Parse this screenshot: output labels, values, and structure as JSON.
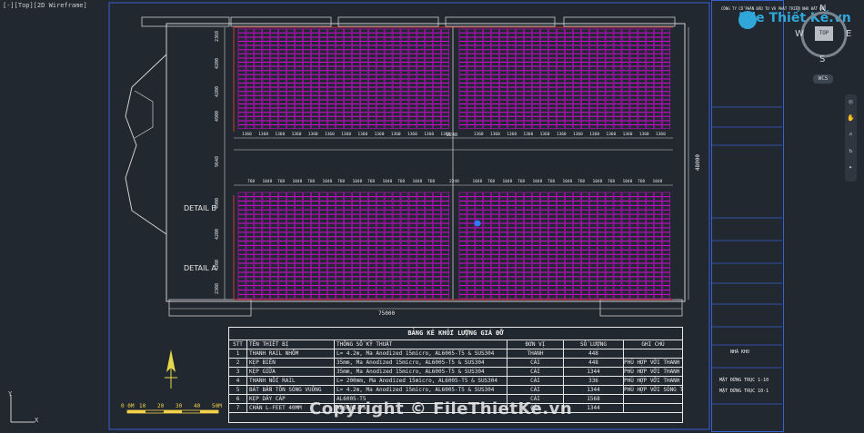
{
  "viewport": {
    "label": "[-][Top][2D Wireframe]"
  },
  "detail_labels": [
    "DETAIL B",
    "DETAIL A"
  ],
  "dimensions": {
    "overall_width": "75000",
    "left_side": [
      "2368",
      "4200",
      "4200",
      "4900",
      "9648",
      "4900",
      "4200",
      "4200",
      "2308"
    ],
    "right_side": "48000",
    "top_spacing": "1360",
    "lower_spacing": [
      "768",
      "1048"
    ],
    "center": "2248"
  },
  "table": {
    "title": "BẢNG KÊ KHỐI LƯỢNG GIÁ ĐỠ",
    "headers": [
      "STT",
      "TÊN THIẾT BỊ",
      "THÔNG SỐ KỸ THUẬT",
      "ĐƠN VỊ",
      "SỐ LƯỢNG",
      "GHI CHÚ"
    ],
    "rows": [
      [
        "1",
        "THANH RAIL NHÔM",
        "L= 4.2m, Ma Anodized 15micro, AL6005-T5 & SUS304",
        "THANH",
        "448",
        ""
      ],
      [
        "2",
        "KẸP BIÊN",
        "35mm, Ma Anodized 15micro, AL6005-T5 & SUS304",
        "CÁI",
        "448",
        "PHÙ HỢP VỚI THANH RAIL"
      ],
      [
        "3",
        "KẸP GIỮA",
        "35mm, Ma Anodized 15micro, AL6005-T5 & SUS304",
        "CÁI",
        "1344",
        "PHÙ HỢP VỚI THANH RAIL"
      ],
      [
        "4",
        "THANH NỐI RAIL",
        "L= 200mm, Ma Anodized 15micro, AL6005-T5 & SUS304",
        "CÁI",
        "336",
        "PHÙ HỢP VỚI THANH RAIL"
      ],
      [
        "5",
        "BÁT BẮN TÔN SÓNG VUÔNG",
        "L= 4.2m, Ma Anodized 15micro, AL6005-T5 & SUS304",
        "CÁI",
        "1344",
        "PHÙ HỢP VỚI SÓNG TÔN"
      ],
      [
        "6",
        "KẸP DÂY CÁP",
        "AL6005-T5",
        "CÁI",
        "1568",
        ""
      ],
      [
        "7",
        "CHÂN L-FEET 40MM",
        "AL6005-T5",
        "CÁI",
        "1344",
        ""
      ]
    ]
  },
  "scale_bar": {
    "labels": [
      "0 0M",
      "10",
      "20",
      "30",
      "40",
      "50M"
    ]
  },
  "title_block": {
    "company": "CÔNG TY CỔ PHẦN ĐẦU TƯ VÀ PHÁT TRIỂN NHÀ ĐẤT ĐỎ",
    "building": "NHÀ KHO",
    "drawing_title_1": "MẶT ĐỨNG TRỤC 1-10",
    "drawing_title_2": "MẶT ĐỨNG TRỤC 10-1"
  },
  "navcube": {
    "north": "N",
    "south": "S",
    "west": "W",
    "east": "E",
    "top": "TOP",
    "wcs": "WCS"
  },
  "ucs": {
    "x": "X",
    "y": "Y"
  },
  "watermark": "Copyright © FileThietKe.vn",
  "brand": "File Thiết Kế.vn",
  "colors": {
    "background": "#212830",
    "panel": "#ff00ff",
    "frame": "#3a5fd0",
    "rail": "#ff3b3b"
  }
}
